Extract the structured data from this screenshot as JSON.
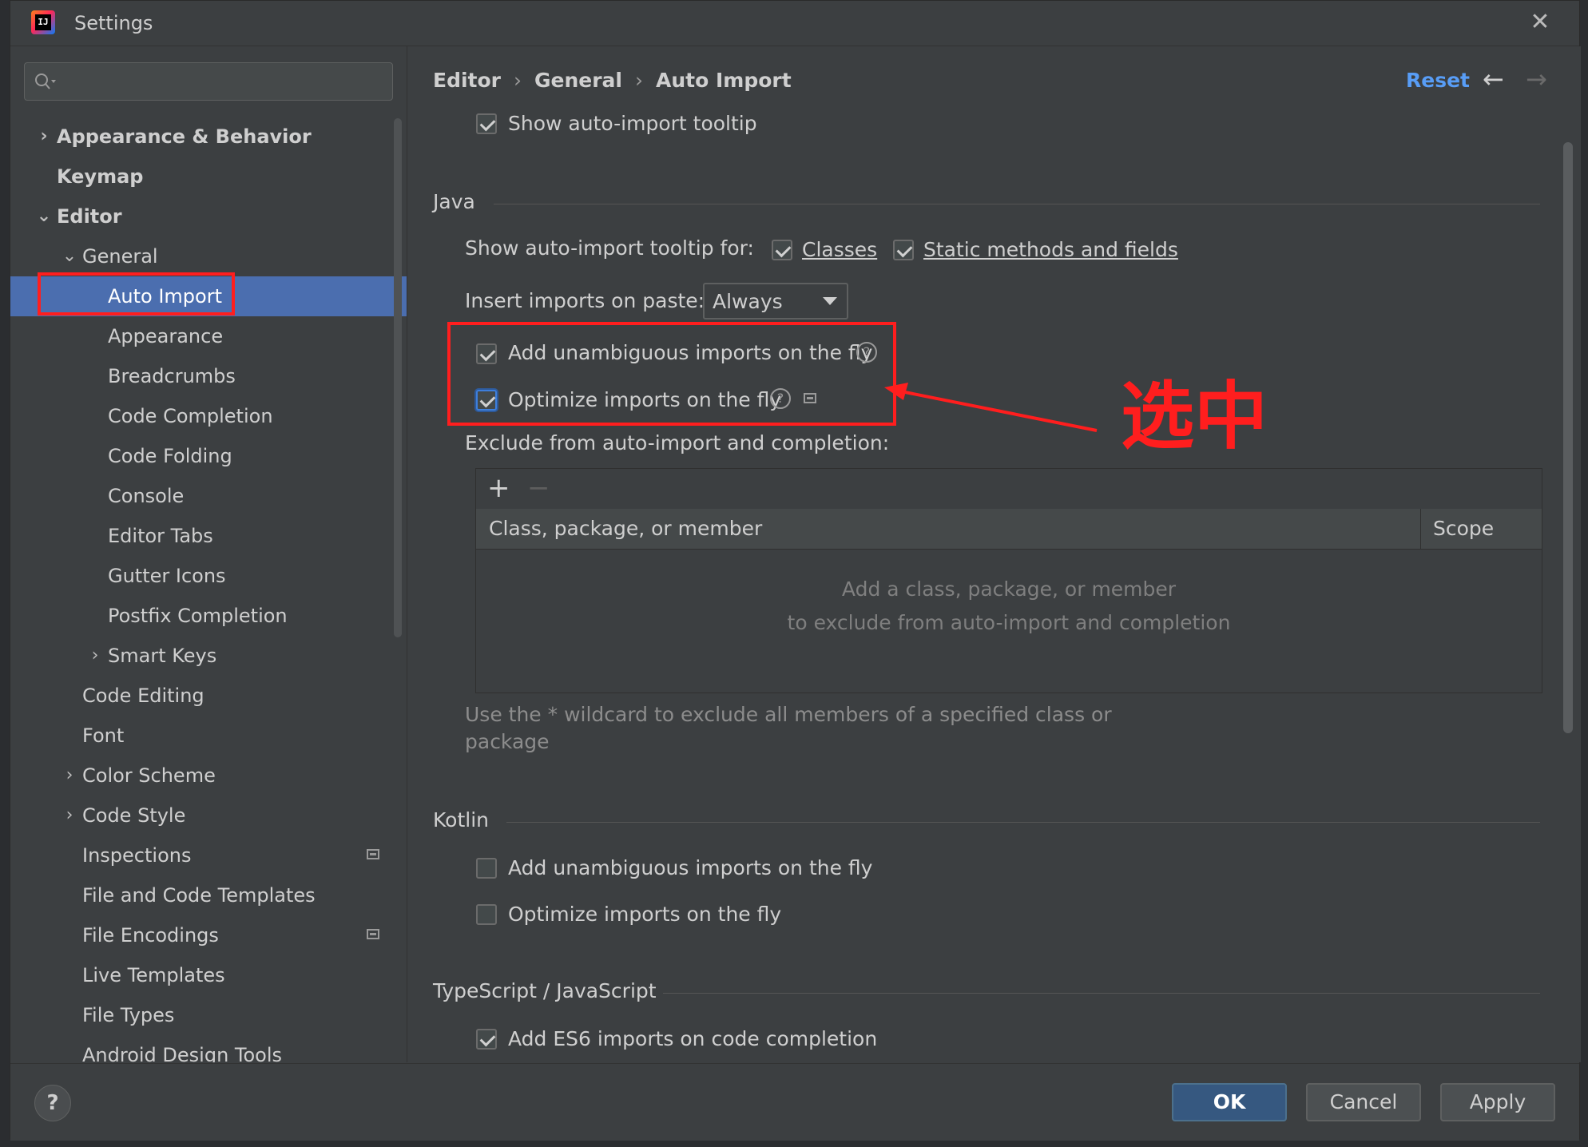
{
  "window": {
    "title": "Settings",
    "close_icon": "close-icon",
    "app_icon": "intellij-idea-icon"
  },
  "search": {
    "placeholder": "",
    "icon": "search-icon"
  },
  "sidebar": {
    "items": [
      {
        "label": "Appearance & Behavior",
        "expander": "collapsed"
      },
      {
        "label": "Keymap"
      },
      {
        "label": "Editor",
        "expander": "expanded"
      },
      {
        "label": "General",
        "expander": "expanded"
      },
      {
        "label": "Auto Import",
        "selected": true
      },
      {
        "label": "Appearance"
      },
      {
        "label": "Breadcrumbs"
      },
      {
        "label": "Code Completion"
      },
      {
        "label": "Code Folding"
      },
      {
        "label": "Console"
      },
      {
        "label": "Editor Tabs"
      },
      {
        "label": "Gutter Icons"
      },
      {
        "label": "Postfix Completion"
      },
      {
        "label": "Smart Keys",
        "expander": "collapsed"
      },
      {
        "label": "Code Editing"
      },
      {
        "label": "Font"
      },
      {
        "label": "Color Scheme",
        "expander": "collapsed"
      },
      {
        "label": "Code Style",
        "expander": "collapsed"
      },
      {
        "label": "Inspections",
        "badge": "project-scope-icon"
      },
      {
        "label": "File and Code Templates"
      },
      {
        "label": "File Encodings",
        "badge": "project-scope-icon"
      },
      {
        "label": "Live Templates"
      },
      {
        "label": "File Types"
      },
      {
        "label": "Android Design Tools"
      }
    ]
  },
  "breadcrumb": {
    "parts": [
      "Editor",
      "General",
      "Auto Import"
    ],
    "separator": "›"
  },
  "toolbar": {
    "reset_label": "Reset",
    "back_icon": "arrow-left-icon",
    "forward_icon": "arrow-right-icon"
  },
  "general": {
    "show_tooltip": {
      "label": "Show auto-import tooltip",
      "checked": true
    }
  },
  "java": {
    "title": "Java",
    "tooltip_for_label": "Show auto-import tooltip for:",
    "classes": {
      "label": "Classes",
      "checked": true
    },
    "static_members": {
      "label": "Static methods and fields",
      "checked": true
    },
    "insert_on_paste_label": "Insert imports on paste:",
    "insert_on_paste_value": "Always",
    "add_unambiguous": {
      "label": "Add unambiguous imports on the fly",
      "checked": true
    },
    "optimize": {
      "label": "Optimize imports on the fly",
      "checked": true
    },
    "exclude_label": "Exclude from auto-import and completion:",
    "table": {
      "add": "+",
      "remove": "−",
      "columns": [
        "Class, package, or member",
        "Scope"
      ],
      "empty_line1": "Add a class, package, or member",
      "empty_line2": "to exclude from auto-import and completion"
    },
    "hint_line1": "Use the * wildcard to exclude all members of a specified class or",
    "hint_line2": "package"
  },
  "kotlin": {
    "title": "Kotlin",
    "add_unambiguous": {
      "label": "Add unambiguous imports on the fly",
      "checked": false
    },
    "optimize": {
      "label": "Optimize imports on the fly",
      "checked": false
    }
  },
  "typescript": {
    "title": "TypeScript / JavaScript",
    "es6": {
      "label": "Add ES6 imports on code completion",
      "checked": true
    }
  },
  "footer": {
    "help": "?",
    "ok": "OK",
    "cancel": "Cancel",
    "apply": "Apply"
  },
  "annotation": {
    "text": "选中",
    "color": "#ff1e1e"
  },
  "colors": {
    "selection": "#4b6eaf",
    "link": "#589df6",
    "background": "#3c3f41"
  }
}
